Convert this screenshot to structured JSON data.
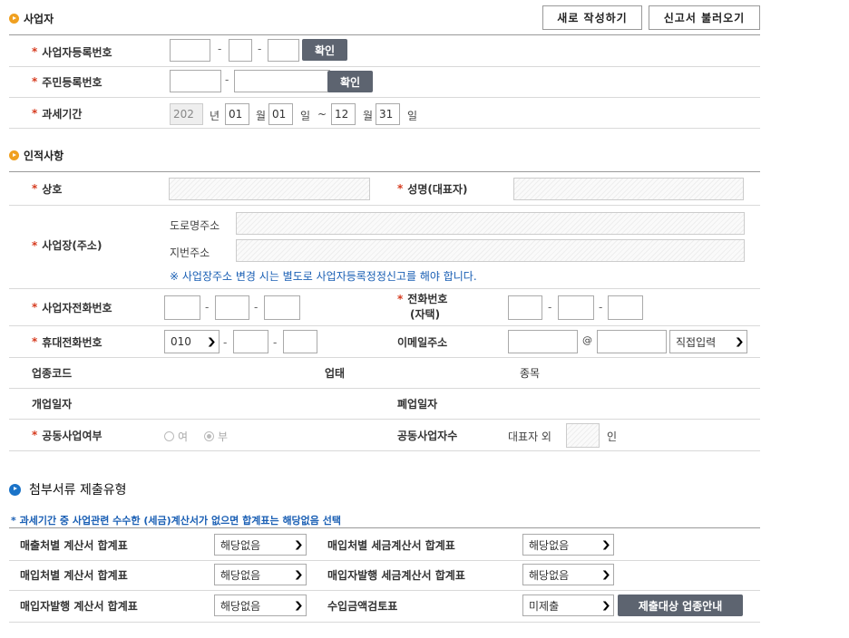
{
  "business": {
    "section_title": "사업자",
    "btn_new": "새로 작성하기",
    "btn_load": "신고서 불러오기",
    "rows": {
      "biz_reg_no": "사업자등록번호",
      "resident_no": "주민등록번호",
      "tax_period": "과세기간"
    },
    "confirm_label": "확인",
    "sep": "-",
    "period": {
      "year": "202",
      "year_unit": "년",
      "start_month": "01",
      "month_unit": "월",
      "start_day": "01",
      "day_unit": "일",
      "tilde": "~",
      "end_month": "12",
      "end_day": "31"
    }
  },
  "personal": {
    "section_title": "인적사항",
    "trade_name": "상호",
    "rep_name": "성명(대표자)",
    "address": "사업장(주소)",
    "road_addr": "도로명주소",
    "lot_addr": "지번주소",
    "addr_note": "※ 사업장주소 변경 시는 별도로 사업자등록정정신고를 해야 합니다.",
    "biz_phone": "사업자전화번호",
    "home_phone_1": "전화번호",
    "home_phone_2": "(자택)",
    "mobile": "휴대전화번호",
    "mobile_prefix": "010",
    "email": "이메일주소",
    "at": "@",
    "email_domain": "직접입력",
    "industry_code": "업종코드",
    "business_type": "업태",
    "item": "종목",
    "open_date": "개업일자",
    "close_date": "폐업일자",
    "joint": "공동사업여부",
    "yes": "여",
    "no": "부",
    "joint_count": "공동사업자수",
    "rep_other": "대표자 외",
    "persons": "인"
  },
  "attach": {
    "section_title": "첨부서류 제출유형",
    "notice": "* 과세기간 중 사업관련 수수한 (세금)계산서가 없으면 합계표는 해당없음 선택",
    "rows": [
      {
        "l1": "매출처별 계산서 합계표",
        "v1": "해당없음",
        "l2": "매입처별 세금계산서 합계표",
        "v2": "해당없음"
      },
      {
        "l1": "매입처별 계산서 합계표",
        "v1": "해당없음",
        "l2": "매입자발행 세금계산서 합계표",
        "v2": "해당없음"
      },
      {
        "l1": "매입자발행 계산서 합계표",
        "v1": "해당없음",
        "l2": "수입금액검토표",
        "v2": "미제출"
      }
    ],
    "guide_btn": "제출대상 업종안내"
  },
  "colors": {
    "required": "#d63b1f",
    "bullet_orange": "#f0a020",
    "bullet_blue": "#1a73c8",
    "notice_blue": "#1a5fb4",
    "dark_button": "#5d6470"
  }
}
